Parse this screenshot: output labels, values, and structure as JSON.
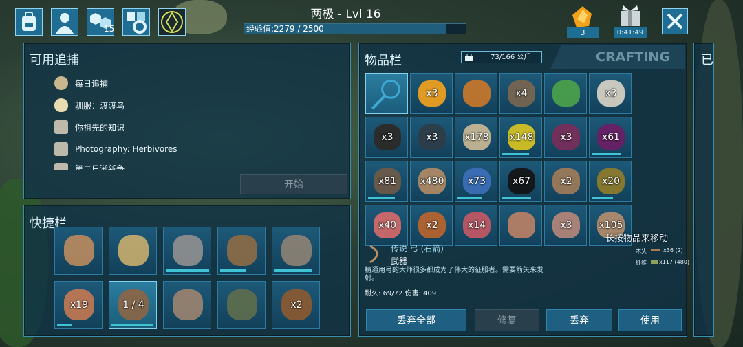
{
  "header": {
    "player_name": "两极 - Lvl 16",
    "xp_label": "经验值:",
    "xp_value": "2279 / 2500",
    "xp_fraction": 0.912
  },
  "top_icons": [
    {
      "name": "backpack-icon"
    },
    {
      "name": "character-icon"
    },
    {
      "name": "engrams-icon",
      "badge": "15"
    },
    {
      "name": "settings-icon"
    },
    {
      "name": "element-icon"
    }
  ],
  "currency": {
    "amber_count": "3",
    "gift_timer": "0:41:49"
  },
  "missions": {
    "title": "可用追捕",
    "items": [
      "每日追捕",
      "驯服：渡渡鸟",
      "你祖先的知识",
      "Photography: Herbivores",
      "第二日渐新争"
    ],
    "start_button": "开始"
  },
  "hotbar": {
    "title": "快捷栏",
    "slots": [
      {
        "name": "hand"
      },
      {
        "name": "map"
      },
      {
        "name": "pickaxe",
        "bar": 0.98
      },
      {
        "name": "torch",
        "bar": 0.6
      },
      {
        "name": "hatchet",
        "bar": 0.85
      },
      {
        "name": "berry-pile",
        "qty": "x19",
        "bar": 0.35
      },
      {
        "name": "bow",
        "qty": "1 / 4",
        "bar": 0.93,
        "selected": true
      },
      {
        "name": "bola"
      },
      {
        "name": "spyglass"
      },
      {
        "name": "cloth",
        "qty": "x2"
      }
    ]
  },
  "inventory": {
    "title": "物品栏",
    "weight": "73/166 公斤",
    "crafting_tab": "CRAFTING",
    "right_panel_label": "已",
    "slots": [
      {
        "name": "search",
        "selected": true
      },
      {
        "name": "amber",
        "qty": "x3"
      },
      {
        "name": "element"
      },
      {
        "name": "spear",
        "qty": "x4"
      },
      {
        "name": "green-arrow"
      },
      {
        "name": "seeds",
        "qty": "x3"
      },
      {
        "name": "feather",
        "qty": "x3"
      },
      {
        "name": "mussels",
        "qty": "x3"
      },
      {
        "name": "thatch",
        "qty": "x178"
      },
      {
        "name": "amarberry",
        "qty": "x148",
        "bar": 0.7
      },
      {
        "name": "azulberry",
        "qty": "x3"
      },
      {
        "name": "tintoberry",
        "qty": "x61",
        "bar": 0.75
      },
      {
        "name": "arrow-bundle",
        "qty": "x81",
        "bar": 0.7
      },
      {
        "name": "wood",
        "qty": "x480"
      },
      {
        "name": "mejoberry",
        "qty": "x73",
        "bar": 0.65
      },
      {
        "name": "narcoberry",
        "qty": "x67",
        "bar": 0.75
      },
      {
        "name": "stick",
        "qty": "x2"
      },
      {
        "name": "stimberry",
        "qty": "x20",
        "bar": 0.55
      },
      {
        "name": "raw-meat",
        "qty": "x40"
      },
      {
        "name": "mushroom",
        "qty": "x2"
      },
      {
        "name": "cooked-meat",
        "qty": "x14"
      },
      {
        "name": "hide",
        "qty": ""
      },
      {
        "name": "stone",
        "qty": "x3"
      },
      {
        "name": "fiber",
        "qty": "x105"
      }
    ]
  },
  "item_detail": {
    "name": "传说 弓 (石箭)",
    "type": "武器",
    "description": "精通用弓的大师很多都成为了伟大的征服者。需要箭矢来发射。",
    "durability_label": "耐久:",
    "durability": "69/72",
    "damage_label": "伤害:",
    "damage": "409",
    "drag_hint": "长按物品来移动",
    "requirements": [
      {
        "label": "木头",
        "value": "x36 (2)"
      },
      {
        "label": "纤维",
        "value": "x117 (480)"
      }
    ]
  },
  "actions": {
    "drop_all": "丢弃全部",
    "repair": "修复",
    "drop": "丢弃",
    "use": "使用"
  },
  "colors": {
    "panel_border": "#3a8fb0",
    "accent": "#41c3d6",
    "bar_fill": "#41c3d6"
  }
}
